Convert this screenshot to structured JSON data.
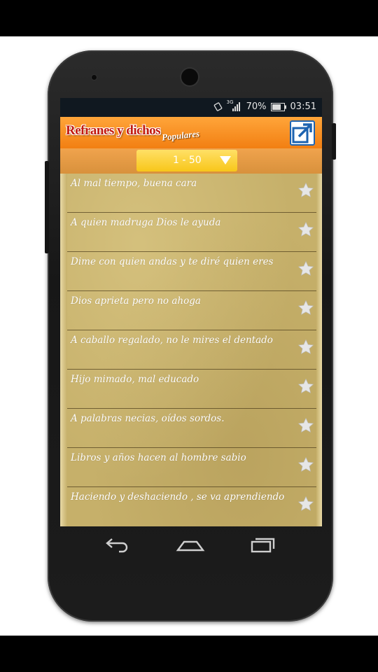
{
  "status_bar": {
    "network": "3G",
    "battery": "70%",
    "time": "03:51"
  },
  "app": {
    "title": "Refranes y dichos",
    "subtitle": "Populares"
  },
  "filter": {
    "selected": "1 - 50"
  },
  "proverbs": [
    {
      "text": "Al mal tiempo, buena cara"
    },
    {
      "text": "A quien madruga Dios le ayuda"
    },
    {
      "text": "Dime con quien andas y te diré quien eres"
    },
    {
      "text": "Dios aprieta pero no ahoga"
    },
    {
      "text": "A caballo regalado, no le mires el dentado"
    },
    {
      "text": "Hijo mimado, mal educado"
    },
    {
      "text": "A palabras necias, oídos sordos."
    },
    {
      "text": "Libros y años hacen al hombre sabio"
    },
    {
      "text": "Haciendo y deshaciendo , se va aprendiendo"
    }
  ],
  "icons": {
    "star": "star-icon",
    "share": "share-icon",
    "back": "back-icon",
    "home": "home-icon",
    "recents": "recents-icon"
  },
  "colors": {
    "appbar": "#f28a1e",
    "dropdown": "#f8c61a",
    "paper": "#c6b06a",
    "share_blue": "#1d63b0",
    "star": "#e5e5e5"
  }
}
